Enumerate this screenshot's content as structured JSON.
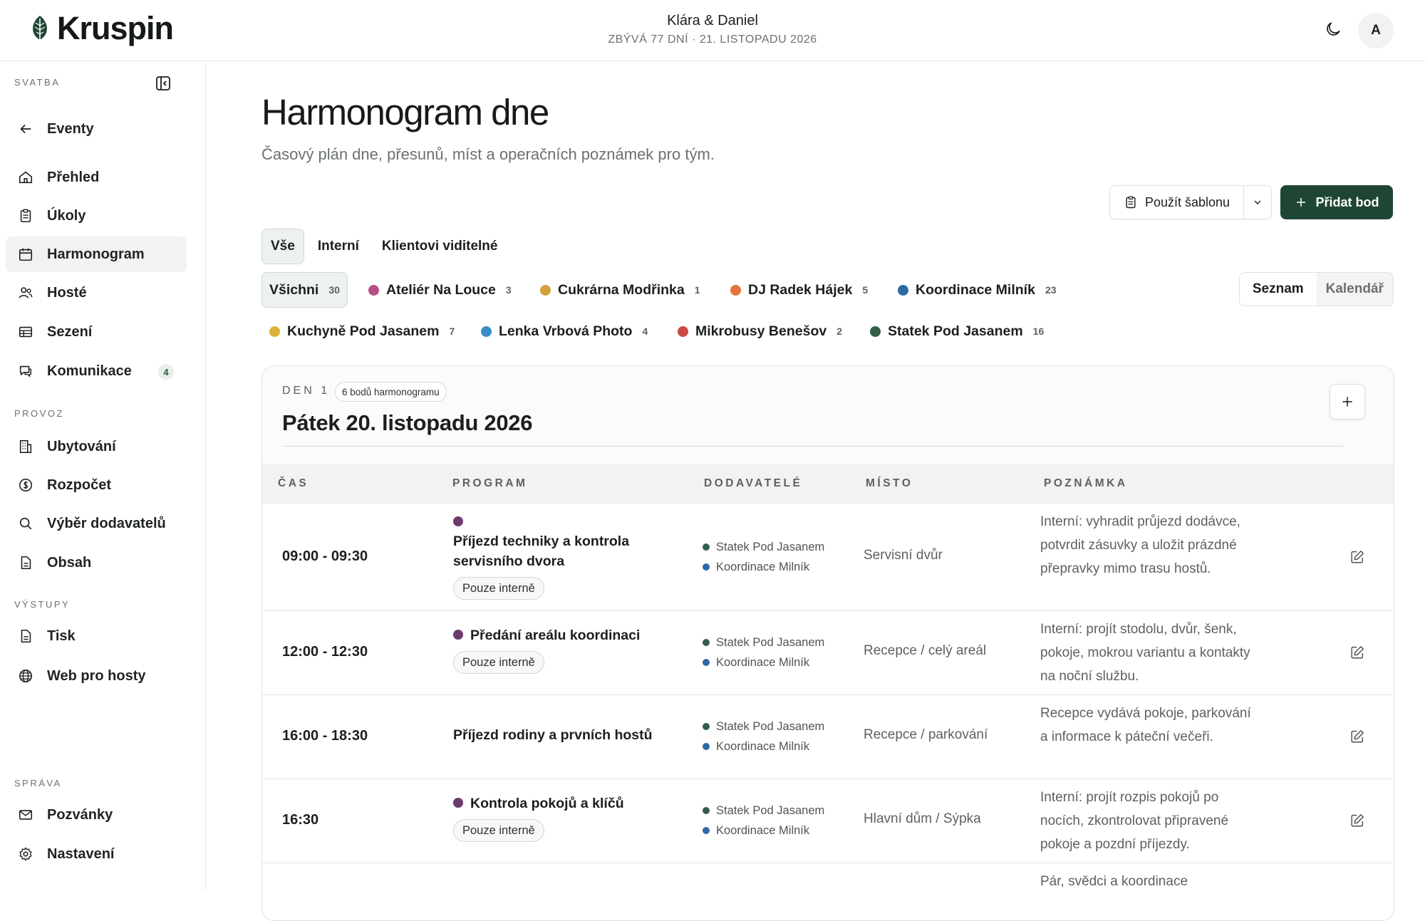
{
  "app": {
    "brand": "Kruspin",
    "couple": "Klára & Daniel",
    "countdown": "ZBÝVÁ 77 DNÍ · 21. LISTOPADU 2026",
    "avatar_initial": "A"
  },
  "sidebar": {
    "section_wedding": "SVATBA",
    "back": "Eventy",
    "items_main": [
      {
        "label": "Přehled",
        "icon": "home-icon"
      },
      {
        "label": "Úkoly",
        "icon": "clipboard-icon"
      },
      {
        "label": "Harmonogram",
        "icon": "calendar-icon",
        "active": true
      },
      {
        "label": "Hosté",
        "icon": "users-icon"
      },
      {
        "label": "Sezení",
        "icon": "table-icon"
      },
      {
        "label": "Komunikace",
        "icon": "chat-icon",
        "badge": "4"
      }
    ],
    "section_ops": "PROVOZ",
    "items_ops": [
      {
        "label": "Ubytování",
        "icon": "building-icon"
      },
      {
        "label": "Rozpočet",
        "icon": "coin-icon"
      },
      {
        "label": "Výběr dodavatelů",
        "icon": "search-icon"
      },
      {
        "label": "Obsah",
        "icon": "document-icon"
      }
    ],
    "section_outputs": "VÝSTUPY",
    "items_outputs": [
      {
        "label": "Tisk",
        "icon": "document-icon"
      },
      {
        "label": "Web pro hosty",
        "icon": "globe-icon"
      }
    ],
    "section_admin": "SPRÁVA",
    "items_admin": [
      {
        "label": "Pozvánky",
        "icon": "mail-icon"
      },
      {
        "label": "Nastavení",
        "icon": "gear-icon"
      }
    ]
  },
  "main": {
    "title": "Harmonogram dne",
    "subtitle": "Časový plán dne, přesunů, míst a operačních poznámek pro tým.",
    "template_button": "Použít šablonu",
    "add_button": "Přidat bod",
    "visibility_tabs": [
      "Vše",
      "Interní",
      "Klientovi viditelné"
    ],
    "view_options": [
      "Seznam",
      "Kalendář"
    ],
    "vendor_filters": [
      {
        "label": "Všichni",
        "count": "30",
        "color": null
      },
      {
        "label": "Ateliér Na Louce",
        "count": "3",
        "color": "#b84d86"
      },
      {
        "label": "Cukrárna Modřinka",
        "count": "1",
        "color": "#cfa33a"
      },
      {
        "label": "DJ Radek Hájek",
        "count": "5",
        "color": "#e2733a"
      },
      {
        "label": "Koordinace Milník",
        "count": "23",
        "color": "#2c6aa6"
      },
      {
        "label": "Kuchyně Pod Jasanem",
        "count": "7",
        "color": "#dcb336"
      },
      {
        "label": "Lenka Vrbová Photo",
        "count": "4",
        "color": "#3a8dc7"
      },
      {
        "label": "Mikrobusy Benešov",
        "count": "2",
        "color": "#c94a43"
      },
      {
        "label": "Statek Pod Jasanem",
        "count": "16",
        "color": "#325e47"
      }
    ],
    "day": {
      "label": "DEN 1",
      "count": "6 bodů harmonogramu",
      "title": "Pátek 20. listopadu 2026",
      "columns": [
        "ČAS",
        "PROGRAM",
        "DODAVATELÉ",
        "MÍSTO",
        "POZNÁMKA"
      ],
      "rows": [
        {
          "time": "09:00 - 09:30",
          "program": "Příjezd techniky a kontrola servisního dvora",
          "internal": "Pouze interně",
          "vendors": [
            "Statek Pod Jasanem",
            "Koordinace Milník"
          ],
          "place": "Servisní dvůr",
          "note": "Interní: vyhradit průjezd dodávce, potvrdit zásuvky a uložit prázdné přepravky mimo trasu hostů."
        },
        {
          "time": "12:00 - 12:30",
          "program": "Předání areálu koordinaci",
          "internal": "Pouze interně",
          "vendors": [
            "Statek Pod Jasanem",
            "Koordinace Milník"
          ],
          "place": "Recepce / celý areál",
          "note": "Interní: projít stodolu, dvůr, šenk, pokoje, mokrou variantu a kontakty na noční službu."
        },
        {
          "time": "16:00 - 18:30",
          "program": "Příjezd rodiny a prvních hostů",
          "internal": null,
          "vendors": [
            "Statek Pod Jasanem",
            "Koordinace Milník"
          ],
          "place": "Recepce / parkování",
          "note": "Recepce vydává pokoje, parkování a informace k páteční večeři."
        },
        {
          "time": "16:30",
          "program": "Kontrola pokojů a klíčů",
          "internal": "Pouze interně",
          "vendors": [
            "Statek Pod Jasanem",
            "Koordinace Milník"
          ],
          "place": "Hlavní dům / Sýpka",
          "note": "Interní: projít rozpis pokojů po nocích, zkontrolovat připravené pokoje a pozdní příjezdy."
        },
        {
          "time": "",
          "program": "",
          "internal": null,
          "vendors": [],
          "place": "",
          "note": "Pár, svědci a koordinace"
        }
      ]
    }
  }
}
